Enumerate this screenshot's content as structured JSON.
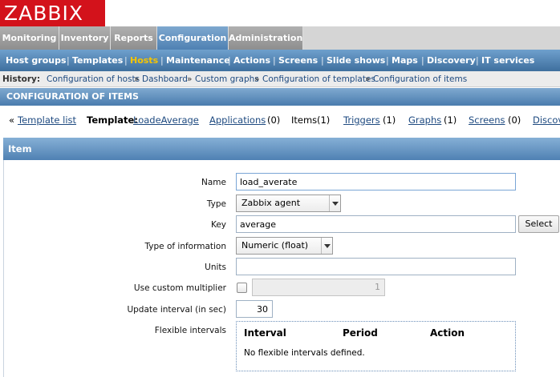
{
  "logo": {
    "text": "ZABBIX",
    "color": "#d3121b"
  },
  "main_menu": {
    "tabs": [
      {
        "label": "Monitoring"
      },
      {
        "label": "Inventory"
      },
      {
        "label": "Reports"
      },
      {
        "label": "Configuration",
        "active": true
      },
      {
        "label": "Administration"
      }
    ]
  },
  "sub_menu": {
    "items": [
      {
        "label": "Host groups"
      },
      {
        "label": "Templates"
      },
      {
        "label": "Hosts",
        "selected": true
      },
      {
        "label": "Maintenance"
      },
      {
        "label": "Actions"
      },
      {
        "label": "Screens"
      },
      {
        "label": "Slide shows"
      },
      {
        "label": "Maps"
      },
      {
        "label": "Discovery"
      },
      {
        "label": "IT services"
      }
    ],
    "separator": "|"
  },
  "history": {
    "label": "History:",
    "crumbs": [
      "Configuration of hosts",
      "Dashboard",
      "Custom graphs",
      "Configuration of templates",
      "Configuration of items"
    ],
    "separator": "»"
  },
  "page_header": {
    "title": "CONFIGURATION OF ITEMS"
  },
  "nav": {
    "back_prefix": "«",
    "template_list": "Template list",
    "template_label": "Template:",
    "template_name": "LoadeAverage",
    "applications": "Applications",
    "applications_count": "(0)",
    "items": "Items",
    "items_count": "(1)",
    "triggers": "Triggers",
    "triggers_count": "(1)",
    "graphs": "Graphs",
    "graphs_count": "(1)",
    "screens": "Screens",
    "screens_count": "(0)",
    "discovery": "Discovery"
  },
  "form": {
    "header": "Item",
    "name_label": "Name",
    "name_value": "load_averate",
    "type_label": "Type",
    "type_value": "Zabbix agent",
    "key_label": "Key",
    "key_value": "average",
    "select_button": "Select",
    "type_info_label": "Type of information",
    "type_info_value": "Numeric (float)",
    "units_label": "Units",
    "units_value": "",
    "custom_multiplier_label": "Use custom multiplier",
    "custom_multiplier_checked": false,
    "multiplier_value": "1",
    "update_interval_label": "Update interval (in sec)",
    "update_interval_value": "30",
    "flexible_label": "Flexible intervals",
    "flexible_table": {
      "columns": [
        "Interval",
        "Period",
        "Action"
      ],
      "empty_message": "No flexible intervals defined."
    }
  },
  "colors": {
    "accent_blue": "#4f81b3",
    "selected_menu": "#f5c400",
    "link": "#1e4a80"
  }
}
